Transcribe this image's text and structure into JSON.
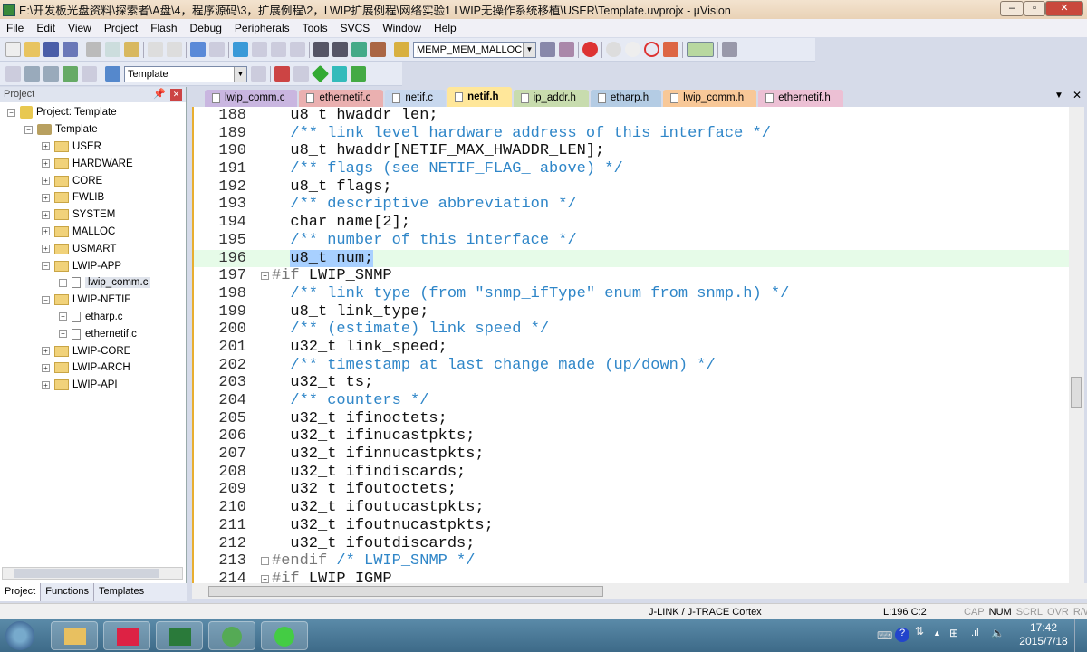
{
  "window": {
    "title": "E:\\开发板光盘资料\\探索者\\A盘\\4，程序源码\\3，扩展例程\\2，LWIP扩展例程\\网络实验1 LWIP无操作系统移植\\USER\\Template.uvprojx - µVision"
  },
  "menu": [
    "File",
    "Edit",
    "View",
    "Project",
    "Flash",
    "Debug",
    "Peripherals",
    "Tools",
    "SVCS",
    "Window",
    "Help"
  ],
  "toolbar": {
    "find_combo": "MEMP_MEM_MALLOC",
    "target_combo": "Template"
  },
  "project_panel": {
    "title": "Project",
    "tree": [
      {
        "label": "Project: Template",
        "level": 0,
        "type": "root"
      },
      {
        "label": "Template",
        "level": 1,
        "type": "target"
      },
      {
        "label": "USER",
        "level": 2,
        "type": "folder"
      },
      {
        "label": "HARDWARE",
        "level": 2,
        "type": "folder"
      },
      {
        "label": "CORE",
        "level": 2,
        "type": "folder"
      },
      {
        "label": "FWLIB",
        "level": 2,
        "type": "folder"
      },
      {
        "label": "SYSTEM",
        "level": 2,
        "type": "folder"
      },
      {
        "label": "MALLOC",
        "level": 2,
        "type": "folder"
      },
      {
        "label": "USMART",
        "level": 2,
        "type": "folder"
      },
      {
        "label": "LWIP-APP",
        "level": 2,
        "type": "folder",
        "expanded": true
      },
      {
        "label": "lwip_comm.c",
        "level": 3,
        "type": "file",
        "selected": true
      },
      {
        "label": "LWIP-NETIF",
        "level": 2,
        "type": "folder",
        "expanded": true
      },
      {
        "label": "etharp.c",
        "level": 3,
        "type": "file"
      },
      {
        "label": "ethernetif.c",
        "level": 3,
        "type": "file"
      },
      {
        "label": "LWIP-CORE",
        "level": 2,
        "type": "folder"
      },
      {
        "label": "LWIP-ARCH",
        "level": 2,
        "type": "folder"
      },
      {
        "label": "LWIP-API",
        "level": 2,
        "type": "folder"
      }
    ],
    "bottom_tabs": [
      "Project",
      "Functions",
      "Templates"
    ]
  },
  "editor_tabs": [
    {
      "label": "lwip_comm.c",
      "color": "#c9b6e0"
    },
    {
      "label": "ethernetif.c",
      "color": "#eab0b0"
    },
    {
      "label": "netif.c",
      "color": "#c8d8ee"
    },
    {
      "label": "netif.h",
      "color": "#ffe79a",
      "active": true
    },
    {
      "label": "ip_addr.h",
      "color": "#c8dcae"
    },
    {
      "label": "etharp.h",
      "color": "#b4cce4"
    },
    {
      "label": "lwip_comm.h",
      "color": "#f8c898"
    },
    {
      "label": "ethernetif.h",
      "color": "#ecc0d4"
    }
  ],
  "code": [
    {
      "n": "188",
      "t": "  u8_t hwaddr_len;",
      "c": ""
    },
    {
      "n": "189",
      "t": "  /** link level hardware address of this interface */",
      "c": "cm"
    },
    {
      "n": "190",
      "t": "  u8_t hwaddr[NETIF_MAX_HWADDR_LEN];",
      "c": ""
    },
    {
      "n": "191",
      "t": "  /** flags (see NETIF_FLAG_ above) */",
      "c": "cm"
    },
    {
      "n": "192",
      "t": "  u8_t flags;",
      "c": ""
    },
    {
      "n": "193",
      "t": "  /** descriptive abbreviation */",
      "c": "cm"
    },
    {
      "n": "194",
      "t": "  char name[2];",
      "c": "kw"
    },
    {
      "n": "195",
      "t": "  /** number of this interface */",
      "c": "cm"
    },
    {
      "n": "196",
      "t": "  u8_t num;",
      "c": "hl"
    },
    {
      "n": "197",
      "t": "#if LWIP_SNMP",
      "c": "pp"
    },
    {
      "n": "198",
      "t": "  /** link type (from \"snmp_ifType\" enum from snmp.h) */",
      "c": "cm"
    },
    {
      "n": "199",
      "t": "  u8_t link_type;",
      "c": ""
    },
    {
      "n": "200",
      "t": "  /** (estimate) link speed */",
      "c": "cm"
    },
    {
      "n": "201",
      "t": "  u32_t link_speed;",
      "c": ""
    },
    {
      "n": "202",
      "t": "  /** timestamp at last change made (up/down) */",
      "c": "cm"
    },
    {
      "n": "203",
      "t": "  u32_t ts;",
      "c": ""
    },
    {
      "n": "204",
      "t": "  /** counters */",
      "c": "cm"
    },
    {
      "n": "205",
      "t": "  u32_t ifinoctets;",
      "c": ""
    },
    {
      "n": "206",
      "t": "  u32_t ifinucastpkts;",
      "c": ""
    },
    {
      "n": "207",
      "t": "  u32_t ifinnucastpkts;",
      "c": ""
    },
    {
      "n": "208",
      "t": "  u32_t ifindiscards;",
      "c": ""
    },
    {
      "n": "209",
      "t": "  u32_t ifoutoctets;",
      "c": ""
    },
    {
      "n": "210",
      "t": "  u32_t ifoutucastpkts;",
      "c": ""
    },
    {
      "n": "211",
      "t": "  u32_t ifoutnucastpkts;",
      "c": ""
    },
    {
      "n": "212",
      "t": "  u32_t ifoutdiscards;",
      "c": ""
    },
    {
      "n": "213",
      "t": "#endif /* LWIP_SNMP */",
      "c": "pp"
    },
    {
      "n": "214",
      "t": "#if LWIP_IGMP",
      "c": "pp"
    }
  ],
  "status": {
    "debugger": "J-LINK / J-TRACE Cortex",
    "position": "L:196 C:2",
    "indicators": [
      "CAP",
      "NUM",
      "SCRL",
      "OVR",
      "R/W"
    ]
  },
  "taskbar": {
    "time": "17:42",
    "date": "2015/7/18"
  }
}
